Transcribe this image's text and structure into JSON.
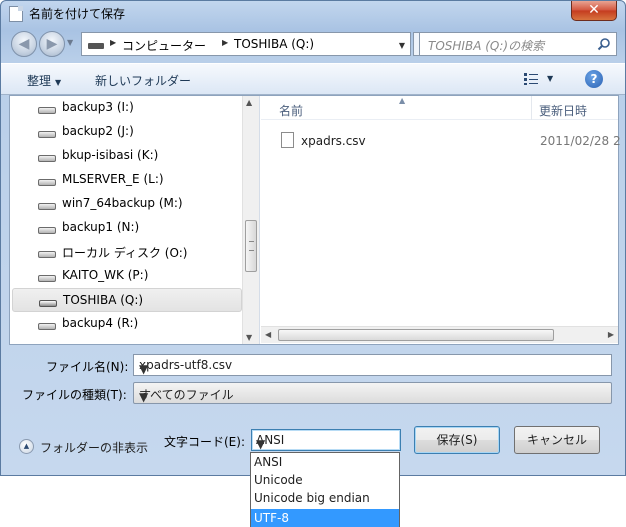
{
  "window": {
    "title": "名前を付けて保存",
    "close_label": "✕"
  },
  "navigation": {
    "breadcrumbs": [
      "コンピューター",
      "TOSHIBA (Q:)"
    ],
    "search_placeholder": "TOSHIBA (Q:)の検索"
  },
  "toolbar": {
    "organize_label": "整理",
    "new_folder_label": "新しいフォルダー",
    "help_label": "?"
  },
  "nav_pane": {
    "items": [
      {
        "label": "backup3 (I:)",
        "selected": false
      },
      {
        "label": "backup2 (J:)",
        "selected": false
      },
      {
        "label": "bkup-isibasi (K:)",
        "selected": false
      },
      {
        "label": "MLSERVER_E (L:)",
        "selected": false
      },
      {
        "label": "win7_64backup (M:)",
        "selected": false
      },
      {
        "label": "backup1 (N:)",
        "selected": false
      },
      {
        "label": "ローカル ディスク (O:)",
        "selected": false
      },
      {
        "label": "KAITO_WK (P:)",
        "selected": false
      },
      {
        "label": "TOSHIBA (Q:)",
        "selected": true
      },
      {
        "label": "backup4 (R:)",
        "selected": false
      }
    ]
  },
  "file_list": {
    "columns": {
      "name": "名前",
      "date": "更新日時"
    },
    "files": [
      {
        "name": "xpadrs.csv",
        "date": "2011/02/28 2"
      }
    ]
  },
  "form": {
    "filename_label": "ファイル名(N):",
    "filename_value": "xpadrs-utf8.csv",
    "filetype_label": "ファイルの種類(T):",
    "filetype_value": "すべてのファイル",
    "folder_toggle_label": "フォルダーの非表示",
    "encoding_label": "文字コード(E):",
    "encoding_value": "ANSI",
    "encoding_options": [
      "ANSI",
      "Unicode",
      "Unicode big endian",
      "UTF-8"
    ],
    "encoding_highlighted": "UTF-8",
    "save_label": "保存(S)",
    "cancel_label": "キャンセル"
  },
  "colors": {
    "highlight": "#3399ff",
    "title_gradient": "#a9c3e3",
    "close_button": "#c43b1f"
  }
}
